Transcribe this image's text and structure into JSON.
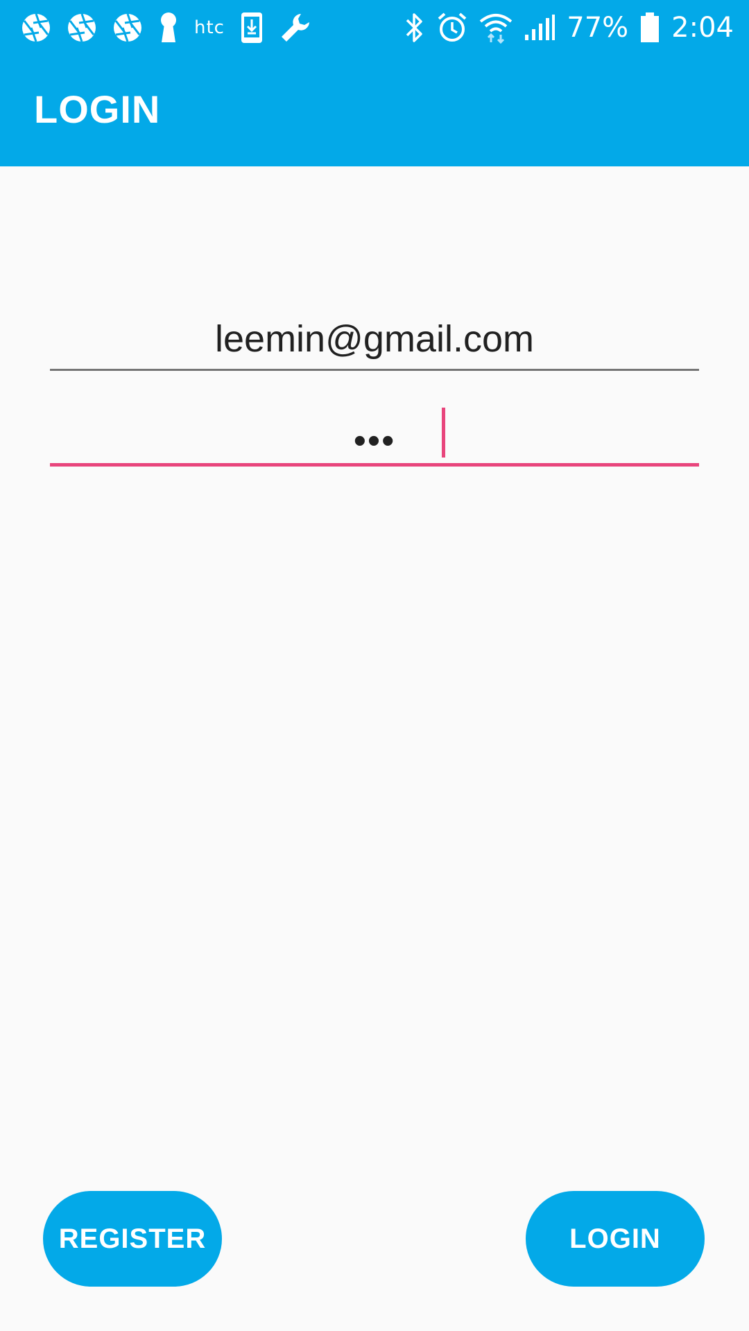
{
  "status_bar": {
    "left_icons": [
      "aperture-icon",
      "aperture-icon",
      "aperture-icon",
      "keyhole-icon",
      "htc-logo",
      "download-icon",
      "wrench-icon"
    ],
    "carrier_logo": "htc",
    "right_icons": [
      "bluetooth-icon",
      "alarm-icon",
      "wifi-icon",
      "signal-icon",
      "battery-icon"
    ],
    "battery_percent": "77%",
    "time": "2:04"
  },
  "app_bar": {
    "title": "LOGIN"
  },
  "form": {
    "email_value": "leemin@gmail.com",
    "password_value": "•••"
  },
  "actions": {
    "register_label": "REGISTER",
    "login_label": "LOGIN"
  },
  "colors": {
    "primary": "#03a9e8",
    "accent": "#e8457c",
    "background": "#fafafa",
    "text": "#212121"
  }
}
